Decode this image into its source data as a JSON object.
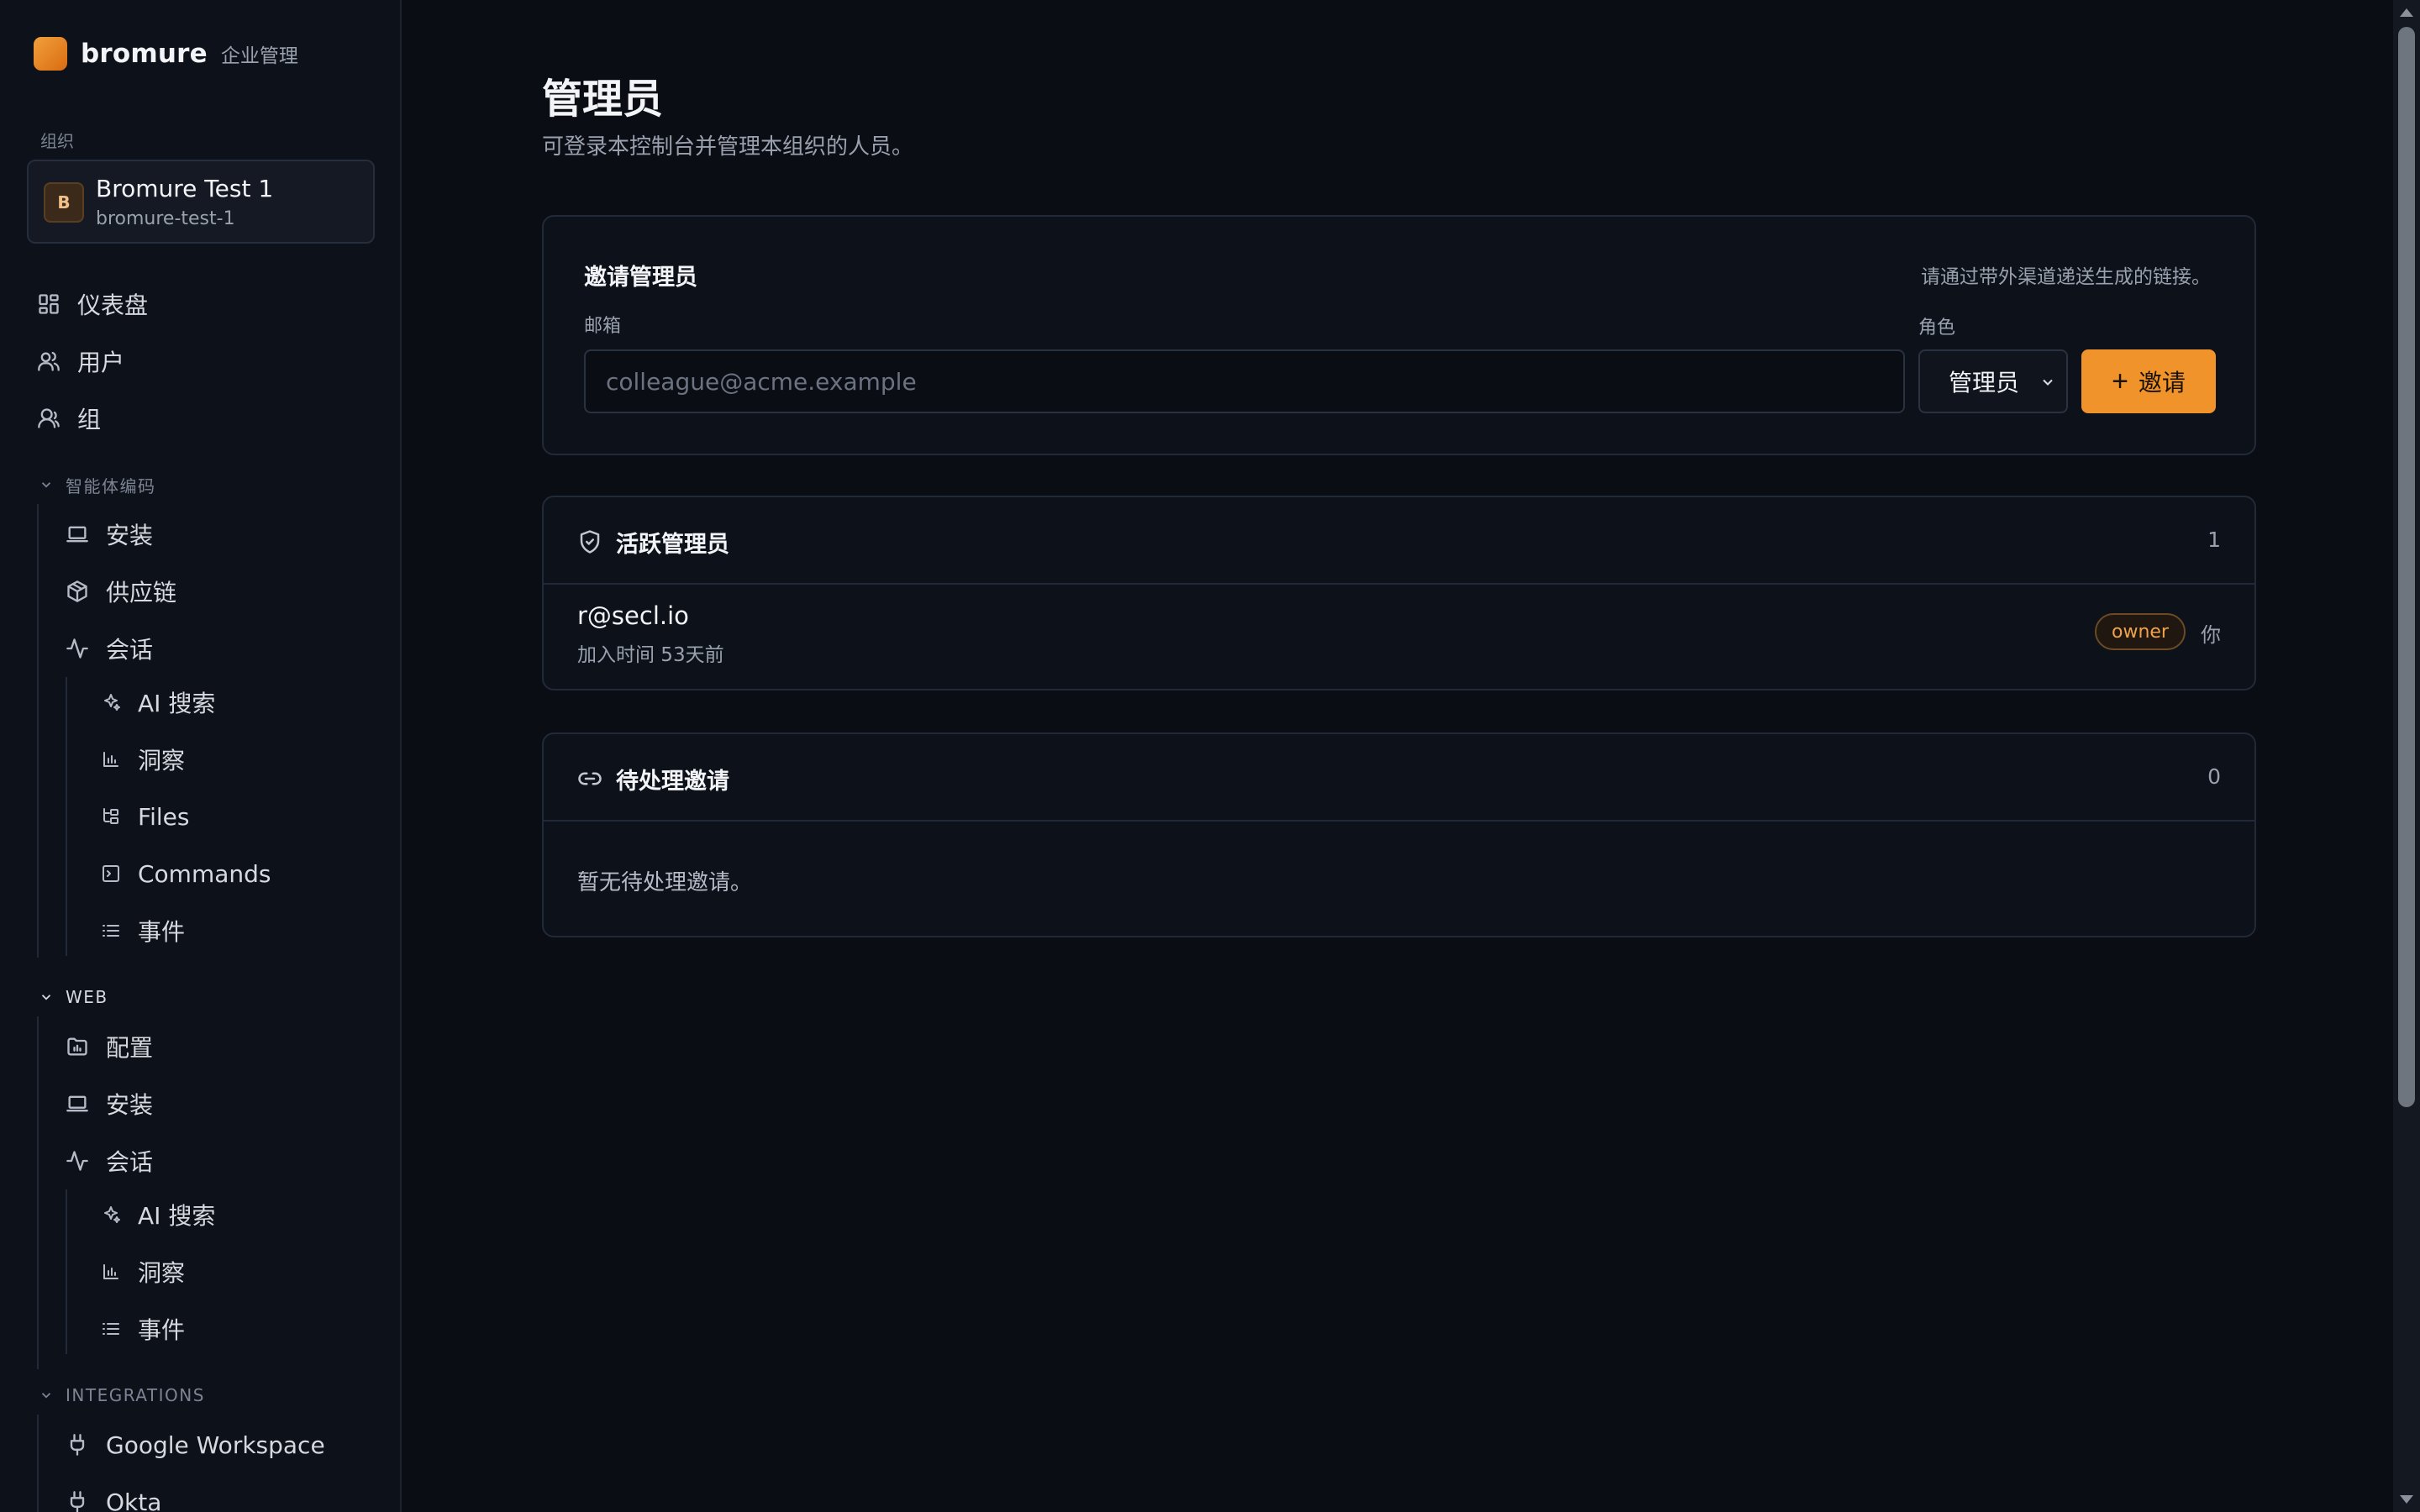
{
  "brand": {
    "name": "bromure",
    "subtitle": "企业管理"
  },
  "sidebar": {
    "org_section_label": "组织",
    "org": {
      "initial": "B",
      "name": "Bromure Test 1",
      "slug": "bromure-test-1"
    },
    "top_items": [
      {
        "label": "仪表盘",
        "icon": "dashboard-icon"
      },
      {
        "label": "用户",
        "icon": "users-icon"
      },
      {
        "label": "组",
        "icon": "group-icon"
      }
    ],
    "agent_coding": {
      "label": "智能体编码",
      "items": [
        {
          "label": "安装",
          "icon": "laptop-icon"
        },
        {
          "label": "供应链",
          "icon": "package-icon"
        },
        {
          "label": "会话",
          "icon": "activity-icon"
        }
      ],
      "session_children": [
        {
          "label": "AI 搜索",
          "icon": "sparkles-icon"
        },
        {
          "label": "洞察",
          "icon": "bar-chart-icon"
        },
        {
          "label": "Files",
          "icon": "folder-tree-icon"
        },
        {
          "label": "Commands",
          "icon": "terminal-icon"
        },
        {
          "label": "事件",
          "icon": "list-icon"
        }
      ]
    },
    "web": {
      "label": "WEB",
      "items": [
        {
          "label": "配置",
          "icon": "folder-config-icon"
        },
        {
          "label": "安装",
          "icon": "laptop-icon"
        },
        {
          "label": "会话",
          "icon": "activity-icon"
        }
      ],
      "session_children": [
        {
          "label": "AI 搜索",
          "icon": "sparkles-icon"
        },
        {
          "label": "洞察",
          "icon": "bar-chart-icon"
        },
        {
          "label": "事件",
          "icon": "list-icon"
        }
      ]
    },
    "integrations": {
      "label": "INTEGRATIONS",
      "items": [
        {
          "label": "Google Workspace",
          "icon": "plug-icon"
        },
        {
          "label": "Okta",
          "icon": "plug-icon"
        }
      ]
    }
  },
  "main": {
    "title": "管理员",
    "subtitle": "可登录本控制台并管理本组织的人员。",
    "invite": {
      "title": "邀请管理员",
      "note": "请通过带外渠道递送生成的链接。",
      "email_label": "邮箱",
      "email_placeholder": "colleague@acme.example",
      "email_value": "",
      "role_label": "角色",
      "role_value": "管理员",
      "button_label": "邀请"
    },
    "active_admins": {
      "title": "活跃管理员",
      "count": "1",
      "rows": [
        {
          "email": "r@secl.io",
          "joined": "加入时间 53天前",
          "badge": "owner",
          "you": "你"
        }
      ]
    },
    "pending": {
      "title": "待处理邀请",
      "count": "0",
      "empty": "暂无待处理邀请。"
    }
  },
  "colors": {
    "accent": "#f0932b",
    "background": "#0a0d14",
    "sidebar": "#0d1119",
    "badge_text": "#f0a24a"
  }
}
